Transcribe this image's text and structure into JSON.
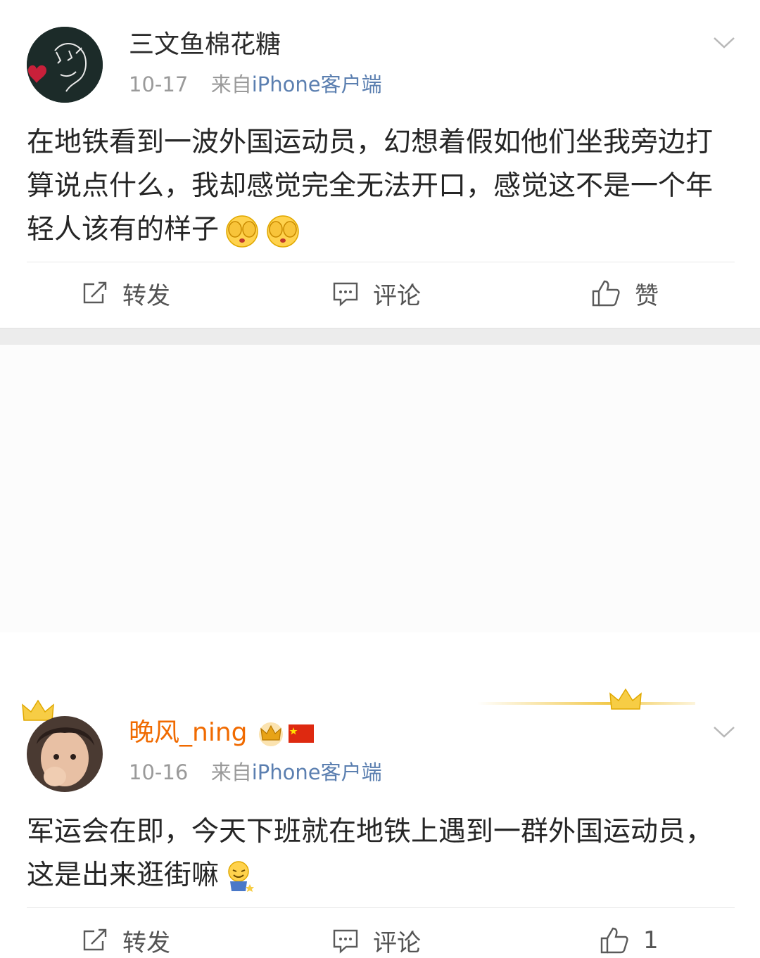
{
  "posts": [
    {
      "username": "三文鱼棉花糖",
      "date": "10-17",
      "source_prefix": "来自",
      "source_client": "iPhone客户端",
      "content": "在地铁看到一波外国运动员，幻想着假如他们坐我旁边打算说点什么，我却感觉完全无法开口，感觉这不是一个年轻人该有的样子",
      "content_emojis": [
        "cover-face-emoji",
        "cover-face-emoji"
      ],
      "actions": {
        "repost": "转发",
        "comment": "评论",
        "like": "赞"
      }
    },
    {
      "username": "晚风_ning",
      "badges": [
        "crown-badge-icon",
        "china-flag-icon"
      ],
      "date": "10-16",
      "source_prefix": "来自",
      "source_client": "iPhone客户端",
      "content": "军运会在即，今天下班就在地铁上遇到一群外国运动员，这是出来逛街嘛",
      "content_emojis": [
        "sweat-smile-figure-emoji"
      ],
      "actions": {
        "repost": "转发",
        "comment": "评论",
        "like": "1"
      }
    }
  ],
  "colors": {
    "username_vip": "#f06a00",
    "source_link": "#5b7fb0",
    "meta_text": "#9a9a9a",
    "separator": "#ececec"
  }
}
